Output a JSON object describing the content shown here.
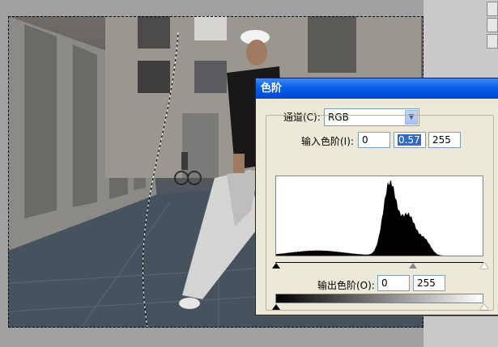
{
  "dialog": {
    "title": "色阶",
    "channel_label": "通道(C):",
    "channel_value": "RGB",
    "input_levels_label": "输入色阶(I):",
    "input_levels": {
      "black": "0",
      "gamma": "0.57",
      "white": "255"
    },
    "output_levels_label": "输出色阶(O):",
    "output_levels": {
      "black": "0",
      "white": "255"
    },
    "histogram_peak_fraction": 0.55,
    "gamma_slider_fraction": 0.66
  },
  "colors": {
    "title_bar": "#0a5ee3",
    "dialog_face": "#ece9d8",
    "selection": "#316ac5"
  },
  "icons": {
    "dropdown": "chevron-down-icon"
  }
}
